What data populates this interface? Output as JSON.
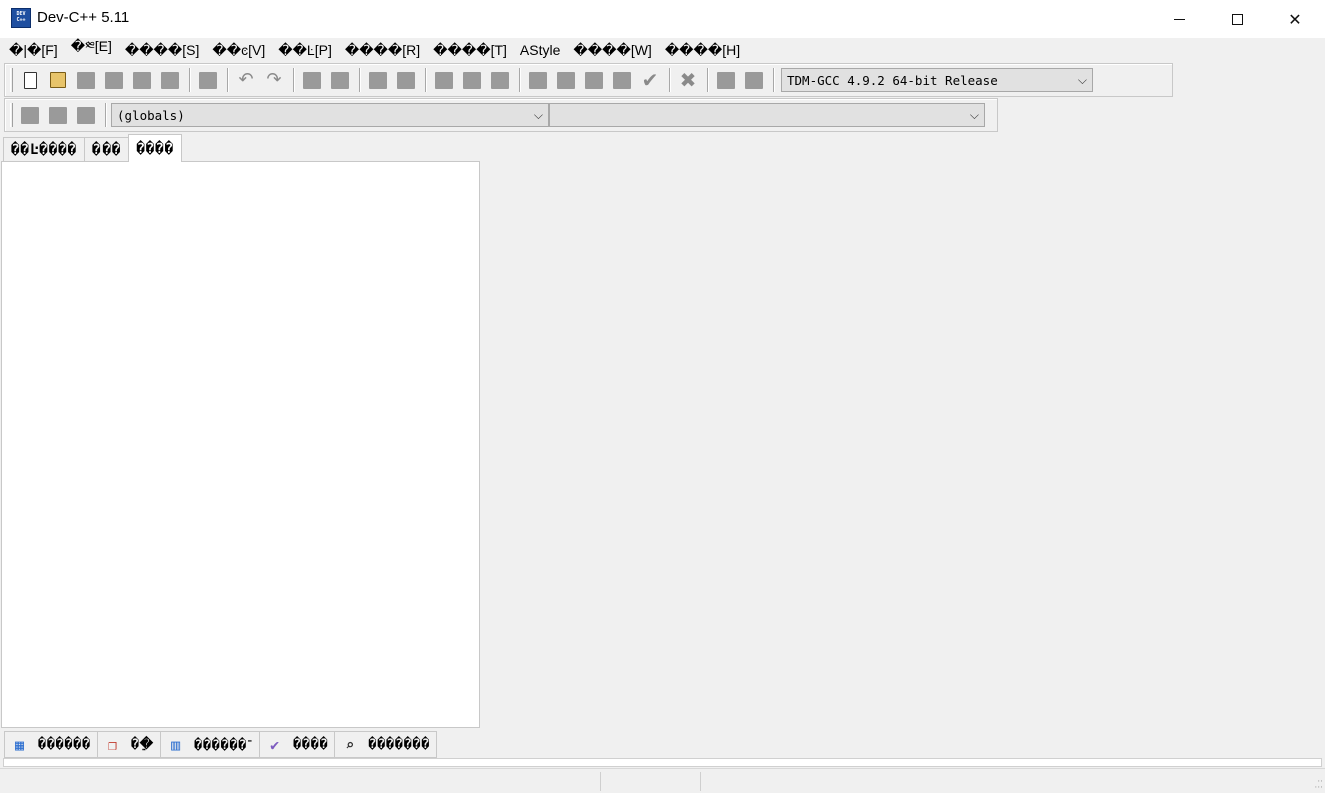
{
  "window": {
    "title": "Dev-C++ 5.11",
    "icon_text": "DEV C++"
  },
  "menu": [
    "�|�[F]",
    "�༭[E]",
    "����[S]",
    "��ͼ[V]",
    "��Ŀ[P]",
    "����[R]",
    "����[T]",
    "AStyle",
    "����[W]",
    "����[H]"
  ],
  "toolbar": {
    "compiler_select": "TDM-GCC 4.9.2 64-bit Release"
  },
  "toolbar2": {
    "scope_select": "(globals)",
    "member_select": ""
  },
  "left_tabs": [
    "��Ŀ����",
    "�࡭��",
    "����"
  ],
  "bottom_tabs": [
    {
      "icon": "compiler-icon",
      "label": "������"
    },
    {
      "icon": "resources-icon",
      "label": "��ֵ"
    },
    {
      "icon": "compile-log-icon",
      "label": "������־"
    },
    {
      "icon": "debug-icon",
      "label": "����"
    },
    {
      "icon": "search-results-icon",
      "label": "�������"
    }
  ],
  "colors": {
    "background": "#f0f0f0",
    "panel": "#ffffff",
    "icon_blue": "#1f4fa0"
  }
}
